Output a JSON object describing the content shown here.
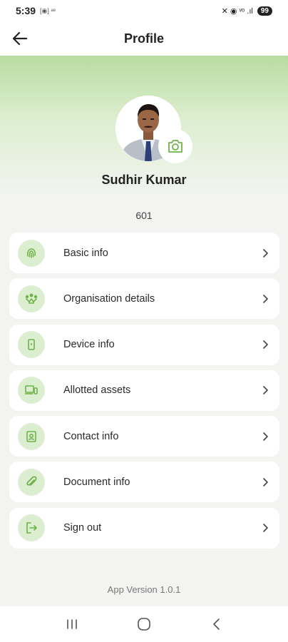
{
  "status_bar": {
    "time": "5:39",
    "left_small": "[◉] ᵃᵉ",
    "right_text": "✕ ◉ ᵛᵒ .ıl",
    "battery": "99"
  },
  "app_bar": {
    "title": "Profile"
  },
  "profile": {
    "name": "Sudhir Kumar",
    "id": "601"
  },
  "menu": {
    "items": [
      {
        "label": "Basic info",
        "icon": "fingerprint-icon"
      },
      {
        "label": "Organisation details",
        "icon": "organisation-icon"
      },
      {
        "label": "Device info",
        "icon": "phone-icon"
      },
      {
        "label": "Allotted assets",
        "icon": "devices-icon"
      },
      {
        "label": "Contact info",
        "icon": "contact-card-icon"
      },
      {
        "label": "Document info",
        "icon": "paperclip-icon"
      },
      {
        "label": "Sign out",
        "icon": "sign-out-icon"
      }
    ]
  },
  "footer": {
    "app_version": "App Version 1.0.1"
  },
  "colors": {
    "accent": "#6fb24a",
    "icon_bg": "#dbeed0",
    "hero_top": "#b8dca1",
    "page_bg": "#f3f4f2"
  }
}
